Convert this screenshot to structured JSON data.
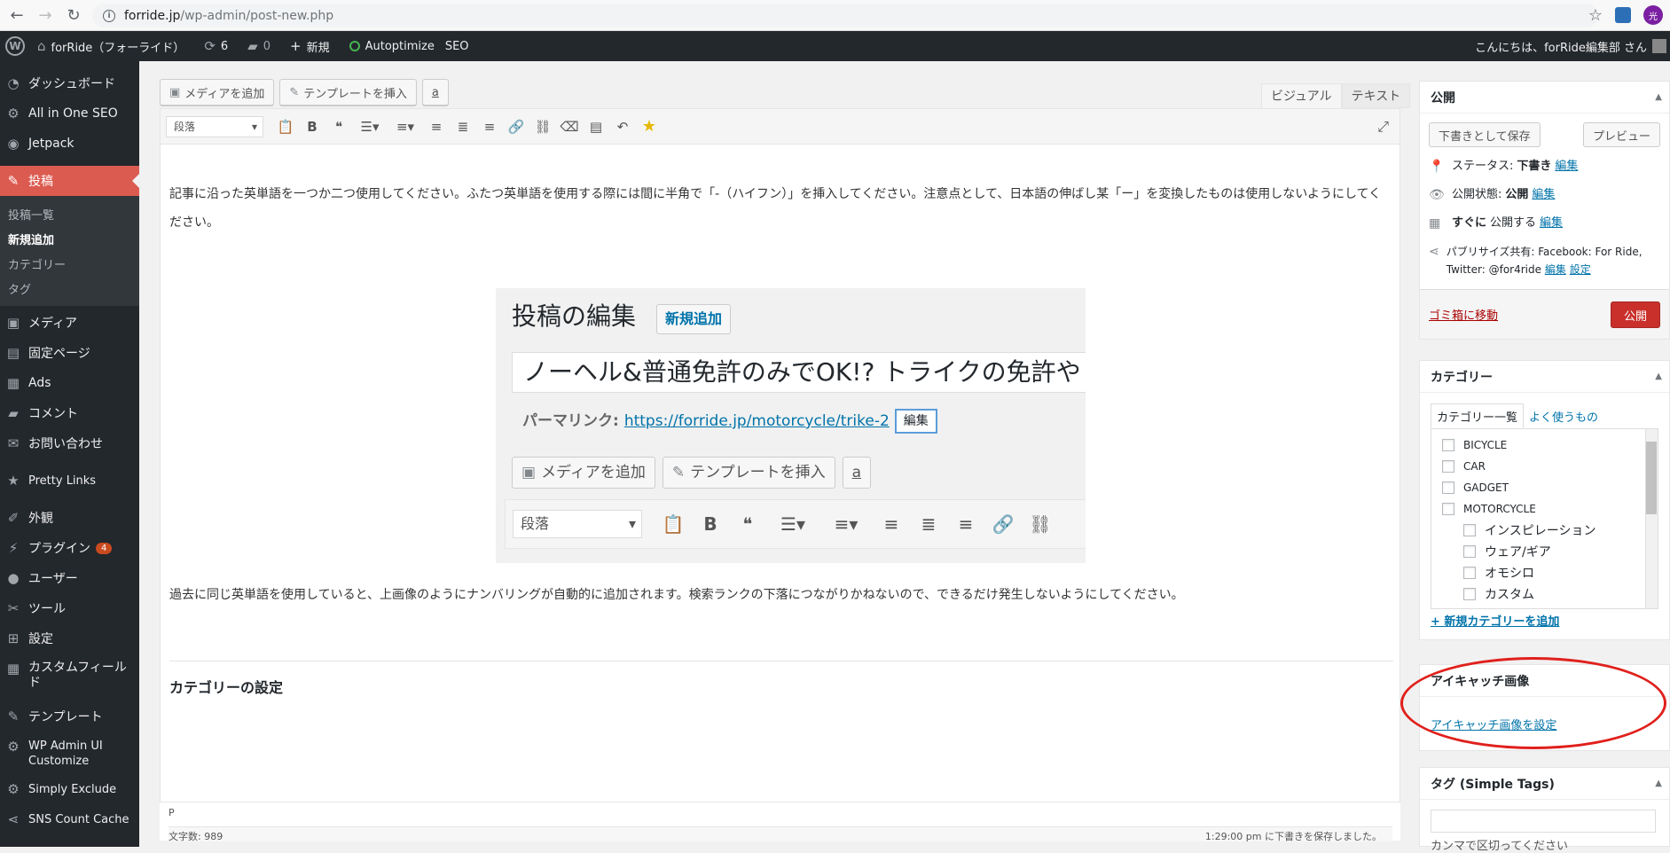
{
  "browser": {
    "url_host": "forride.jp",
    "url_path": "/wp-admin/post-new.php",
    "profile_initial": "光"
  },
  "adminbar": {
    "site_name": "forRide（フォーライド）",
    "updates_count": "6",
    "comments_count": "0",
    "new_label": "新規",
    "autoptimize_label": "Autoptimize",
    "seo_label": "SEO",
    "greeting": "こんにちは、forRide編集部 さん"
  },
  "sidebar": {
    "items": [
      {
        "label": "ダッシュボード",
        "icon": "dashboard-icon"
      },
      {
        "label": "All in One SEO",
        "icon": "gear-icon"
      },
      {
        "label": "Jetpack",
        "icon": "jetpack-icon"
      },
      {
        "label": "投稿",
        "icon": "pin-icon"
      }
    ],
    "submenu": [
      "投稿一覧",
      "新規追加",
      "カテゴリー",
      "タグ"
    ],
    "items2": [
      {
        "label": "メディア",
        "icon": "media-icon"
      },
      {
        "label": "固定ページ",
        "icon": "page-icon"
      },
      {
        "label": "Ads",
        "icon": "ads-icon"
      },
      {
        "label": "コメント",
        "icon": "comment-icon"
      },
      {
        "label": "お問い合わせ",
        "icon": "mail-icon"
      },
      {
        "label": "Pretty Links",
        "icon": "star-icon"
      },
      {
        "label": "外観",
        "icon": "brush-icon"
      },
      {
        "label": "プラグイン",
        "icon": "plugin-icon",
        "badge": "4"
      },
      {
        "label": "ユーザー",
        "icon": "user-icon"
      },
      {
        "label": "ツール",
        "icon": "wrench-icon"
      },
      {
        "label": "設定",
        "icon": "settings-icon"
      },
      {
        "label": "カスタムフィールド",
        "icon": "table-icon"
      },
      {
        "label": "テンプレート",
        "icon": "pencil-icon"
      },
      {
        "label": "WP Admin UI Customize",
        "icon": "gear-icon"
      },
      {
        "label": "Simply Exclude",
        "icon": "gear-icon"
      },
      {
        "label": "SNS Count Cache",
        "icon": "share-icon"
      }
    ]
  },
  "editor": {
    "add_media": "メディアを追加",
    "insert_template": "テンプレートを挿入",
    "amazon": "a",
    "tab_visual": "ビジュアル",
    "tab_text": "テキスト",
    "format": "段落",
    "paragraph1": "記事に沿った英単語を一つか二つ使用してください。ふたつ英単語を使用する際には間に半角で「-（ハイフン）」を挿入してください。注意点として、日本語の伸ばし某「ー」を変換したものは使用しないようにしてください。",
    "paragraph2": "過去に同じ英単語を使用していると、上画像のようにナンバリングが自動的に追加されます。検索ランクの下落につながりかねないので、できるだけ発生しないようにしてください。",
    "heading": "カテゴリーの設定",
    "path": "P",
    "wordcount": "文字数: 989",
    "autosave": "1:29:00 pm に下書きを保存しました。"
  },
  "embedded": {
    "title": "投稿の編集",
    "new_button": "新規追加",
    "post_title": "ノーヘル&普通免許のみでOK!? トライクの免許や",
    "permalink_label": "パーマリンク:",
    "permalink_url": "https://forride.jp/motorcycle/trike-2",
    "edit": "編集",
    "add_media": "メディアを追加",
    "insert_template": "テンプレートを挿入",
    "amazon": "a",
    "format": "段落"
  },
  "publish": {
    "title": "公開",
    "save_draft": "下書きとして保存",
    "preview": "プレビュー",
    "status_label": "ステータス:",
    "status_value": "下書き",
    "visibility_label": "公開状態:",
    "visibility_value": "公開",
    "schedule_value": "すぐに",
    "schedule_label": "公開する",
    "edit": "編集",
    "publicize": "パブリサイズ共有: Facebook: For Ride, Twitter: @for4ride",
    "settings": "設定",
    "trash": "ゴミ箱に移動",
    "publish_btn": "公開"
  },
  "category": {
    "title": "カテゴリー",
    "tab_all": "カテゴリー一覧",
    "tab_popular": "よく使うもの",
    "items": [
      "BICYCLE",
      "CAR",
      "GADGET",
      "MOTORCYCLE"
    ],
    "children": [
      "インスピレーション",
      "ウェア/ギア",
      "オモシロ",
      "カスタム"
    ],
    "add_new": "+ 新規カテゴリーを追加"
  },
  "eyecatch": {
    "title": "アイキャッチ画像",
    "set_link": "アイキャッチ画像を設定"
  },
  "tags": {
    "title": "タグ (Simple Tags)",
    "hint": "カンマで区切ってください"
  }
}
